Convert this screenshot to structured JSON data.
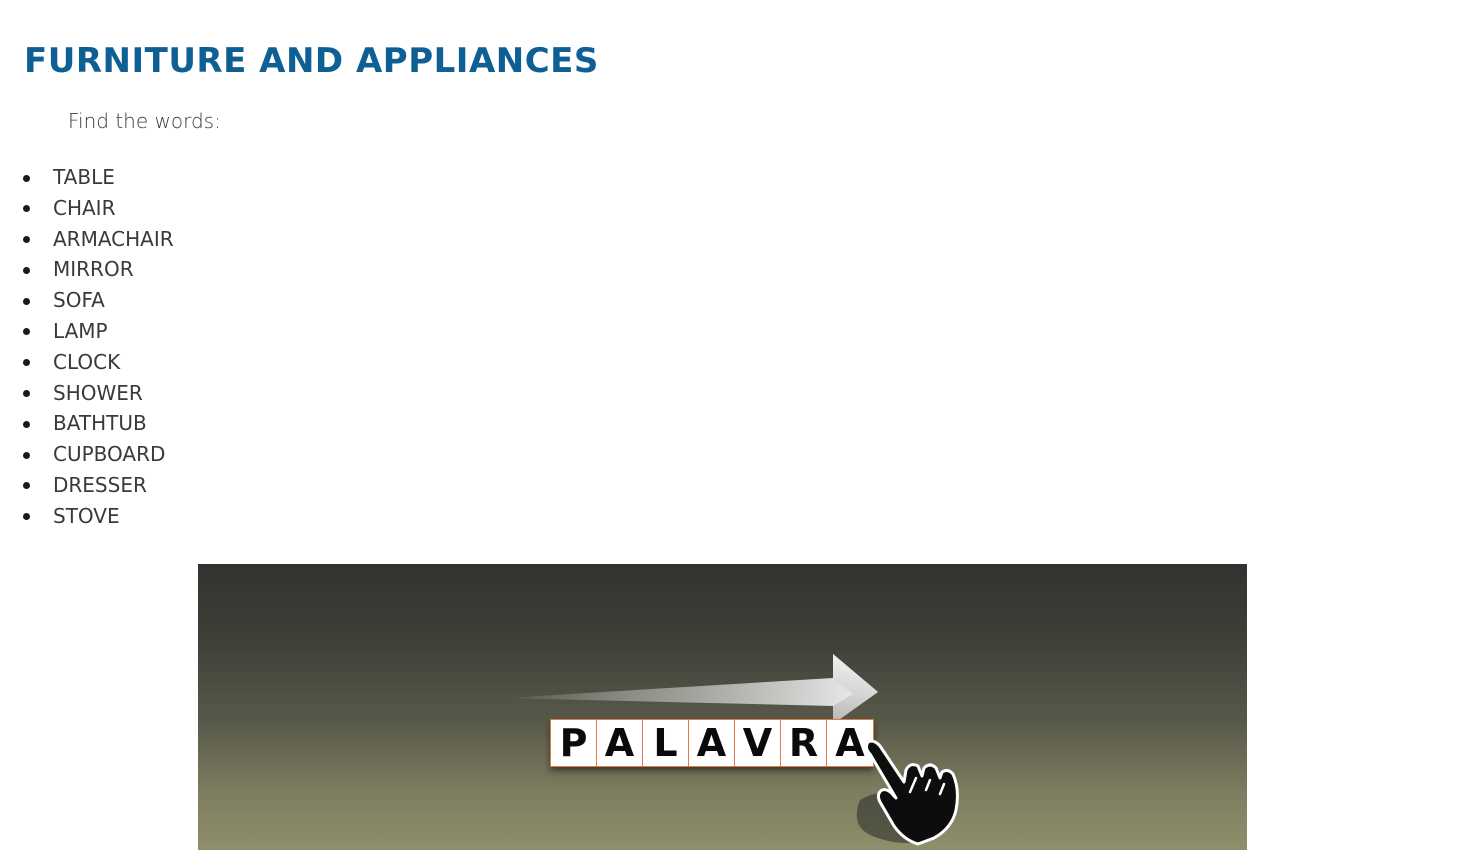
{
  "page": {
    "title": "FURNITURE AND APPLIANCES",
    "instructions": "Find the words:"
  },
  "words": [
    "TABLE",
    "CHAIR",
    "ARMACHAIR",
    "MIRROR",
    "SOFA",
    "LAMP",
    "CLOCK",
    "SHOWER",
    "BATHTUB",
    "CUPBOARD",
    "DRESSER",
    "STOVE"
  ],
  "banner": {
    "tiles": [
      "P",
      "A",
      "L",
      "A",
      "V",
      "R",
      "A"
    ],
    "icons": [
      "arrow-icon",
      "pointing-hand-icon"
    ]
  },
  "colors": {
    "title": "#0e5f93",
    "text": "#3a3a3a",
    "tile_border": "#e07a4a",
    "banner_top": "#323230",
    "banner_bottom": "#8f8f6a"
  }
}
